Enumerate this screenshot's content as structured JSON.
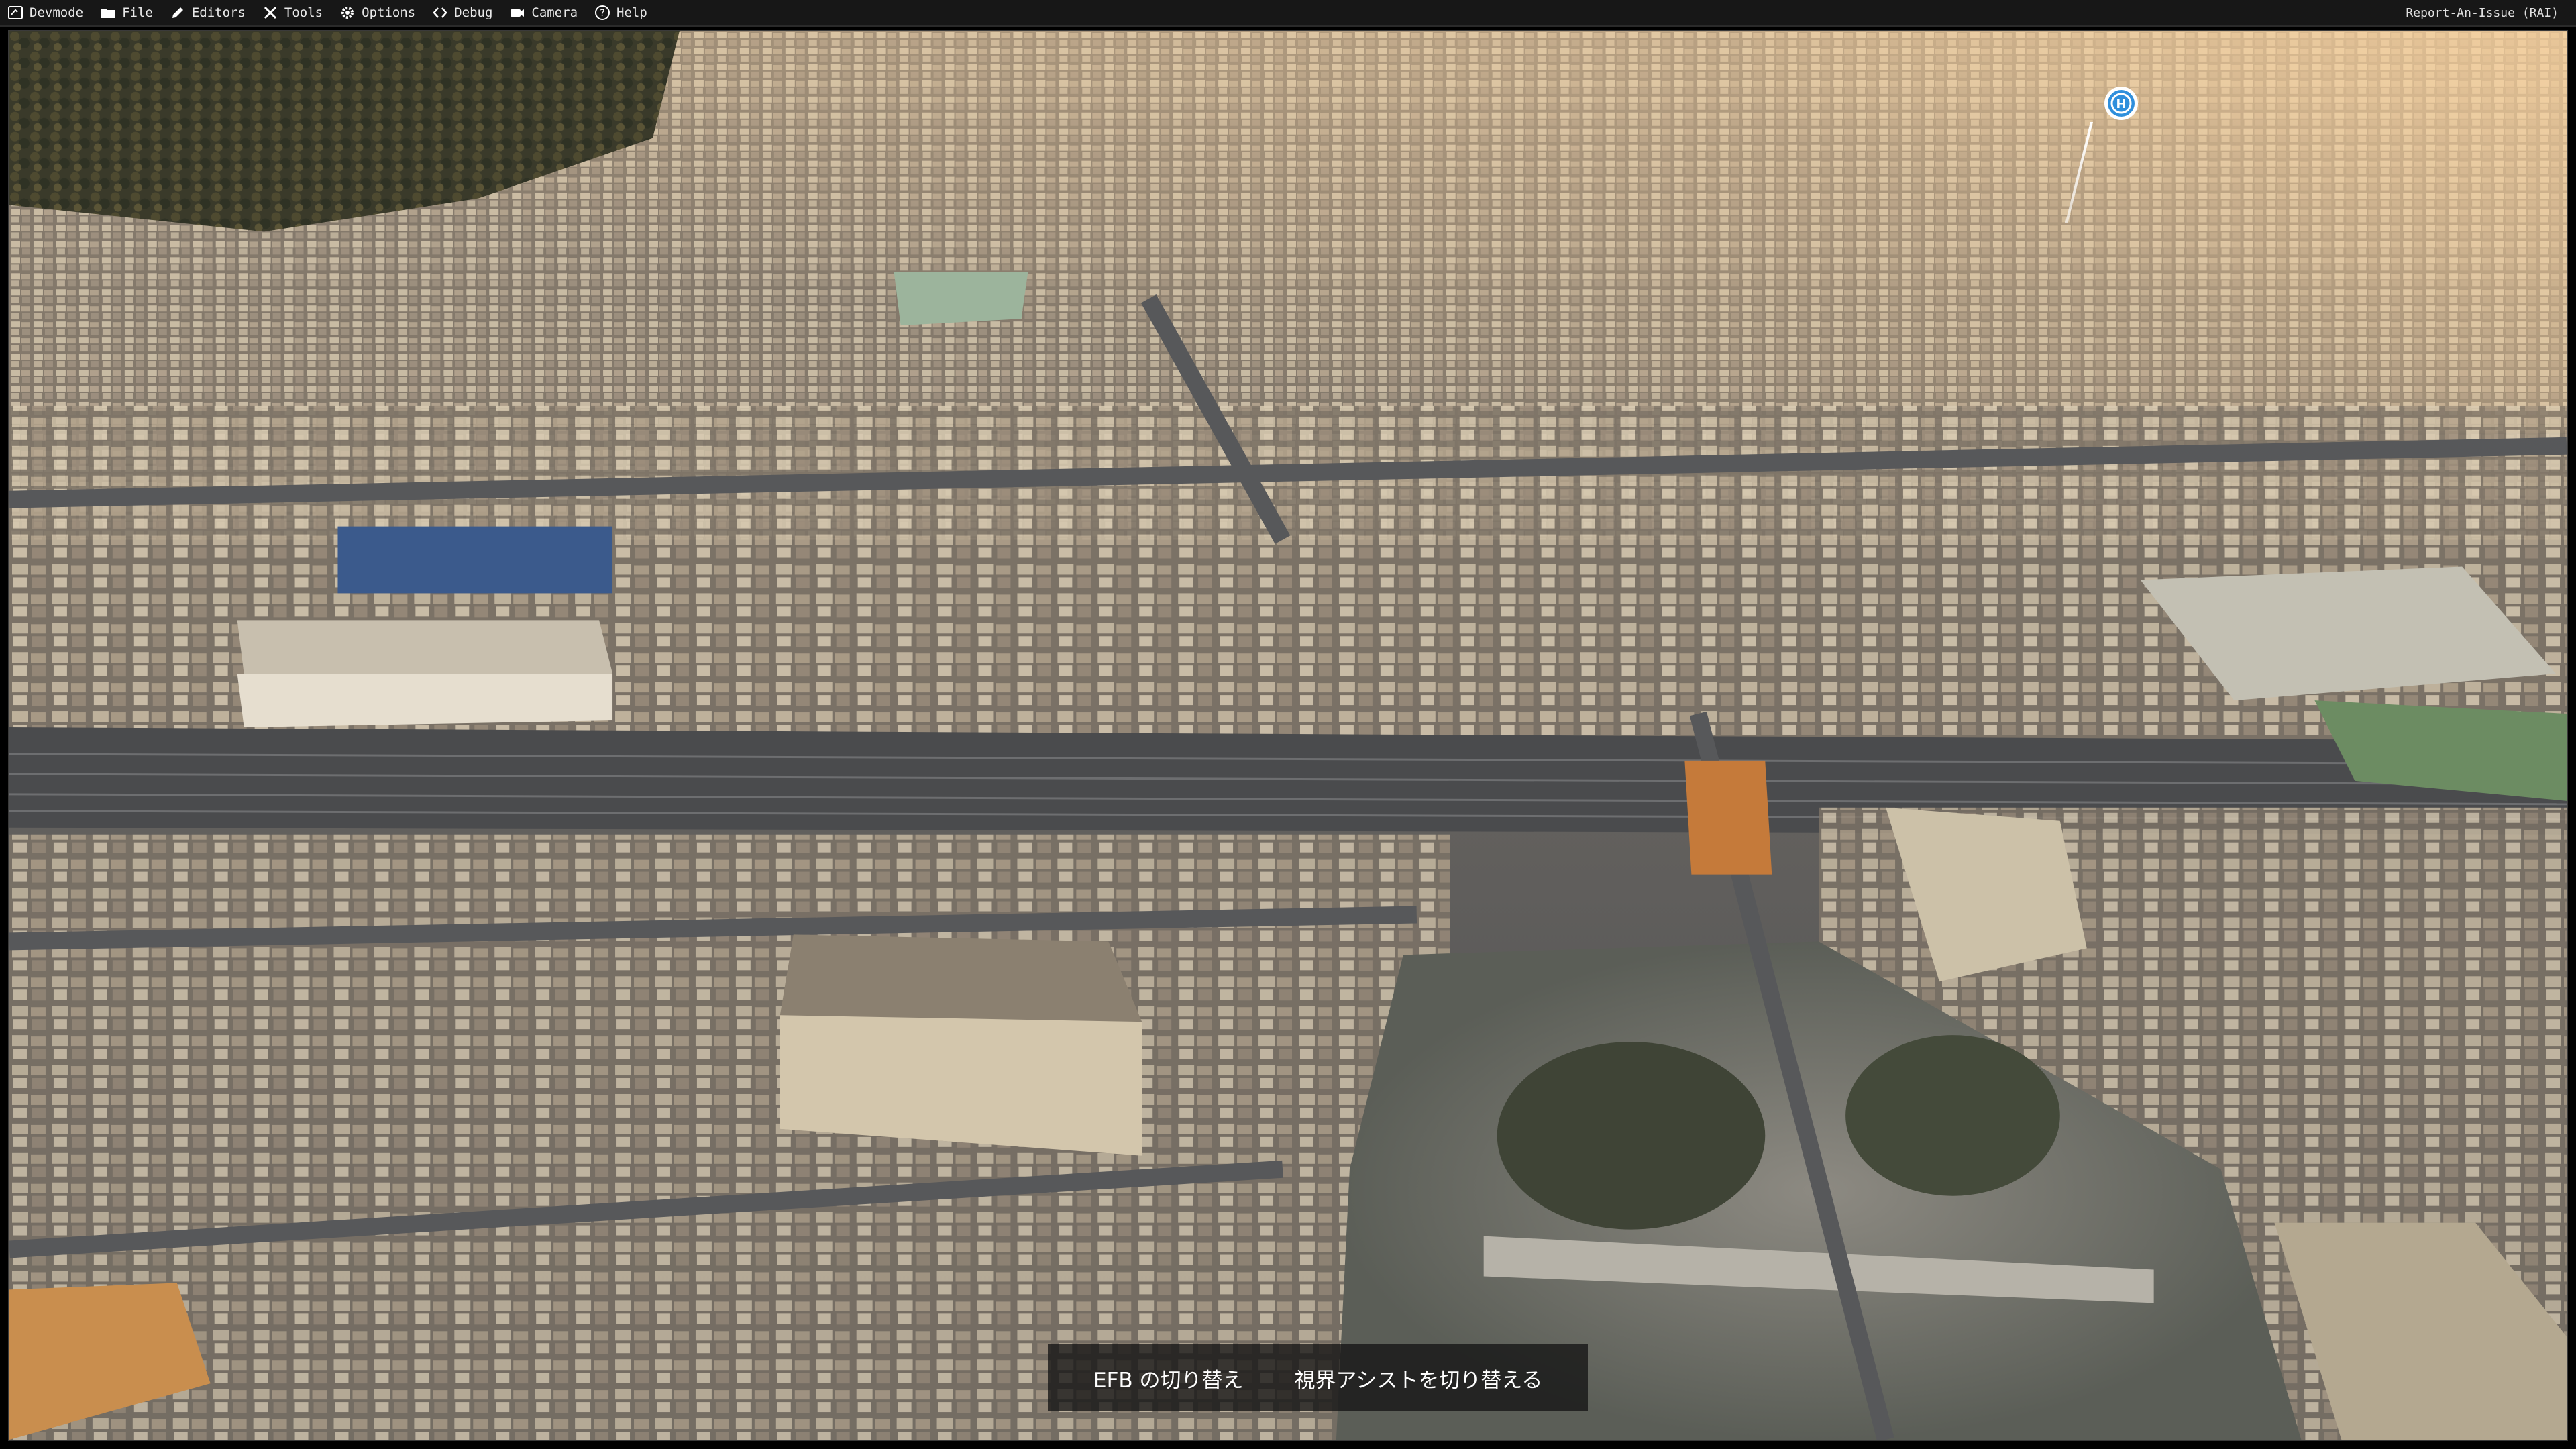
{
  "menubar": {
    "items": [
      {
        "label": "Devmode",
        "icon": "devmode-icon"
      },
      {
        "label": "File",
        "icon": "folder-icon"
      },
      {
        "label": "Editors",
        "icon": "pencil-icon"
      },
      {
        "label": "Tools",
        "icon": "tools-icon"
      },
      {
        "label": "Options",
        "icon": "gear-icon"
      },
      {
        "label": "Debug",
        "icon": "code-brackets-icon"
      },
      {
        "label": "Camera",
        "icon": "camera-icon"
      },
      {
        "label": "Help",
        "icon": "help-icon"
      }
    ],
    "report_label": "Report-An-Issue (RAI)"
  },
  "scene": {
    "description_icon": "poi-marker-icon",
    "poi_marker_letter": "H"
  },
  "bottom_toolbar": {
    "toggle_efb": "EFB の切り替え",
    "toggle_visual_assist": "視界アシストを切り替える"
  },
  "colors": {
    "menubar_bg": "#171717",
    "toolbar_bg": "#141414",
    "marker_accent": "#2f8fdc"
  }
}
